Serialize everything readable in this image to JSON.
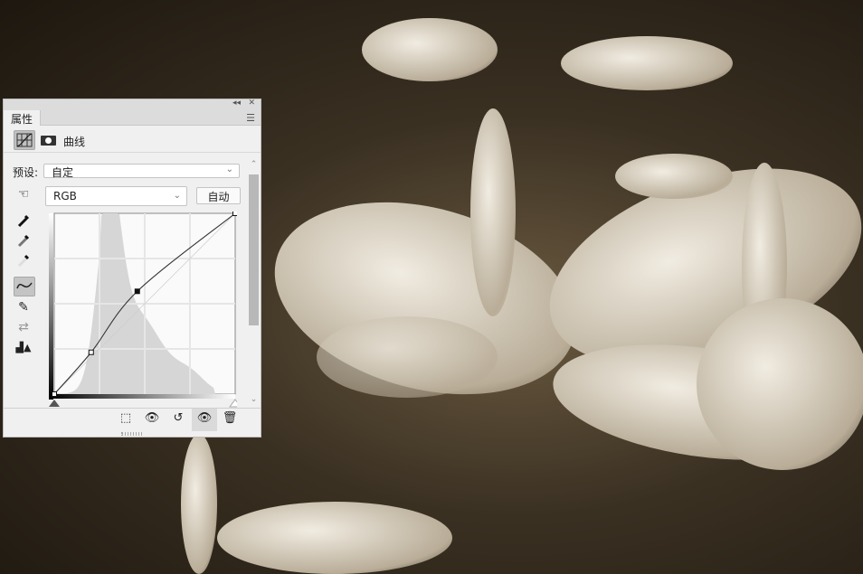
{
  "panel": {
    "collapse_icon": "double-chevron-left",
    "close_icon": "close",
    "tab_label": "属性",
    "header_title": "曲线",
    "preset_label": "预设:",
    "preset_value": "自定",
    "channel_value": "RGB",
    "auto_label": "自动"
  },
  "curve": {
    "points": [
      [
        0,
        0
      ],
      [
        52,
        59
      ],
      [
        117,
        145
      ],
      [
        255,
        255
      ]
    ],
    "selected_point": 2
  },
  "colors": {
    "panel_bg": "#f0f0f0",
    "graph_bg": "#fafafa",
    "histogram": "#d6d6d6"
  }
}
